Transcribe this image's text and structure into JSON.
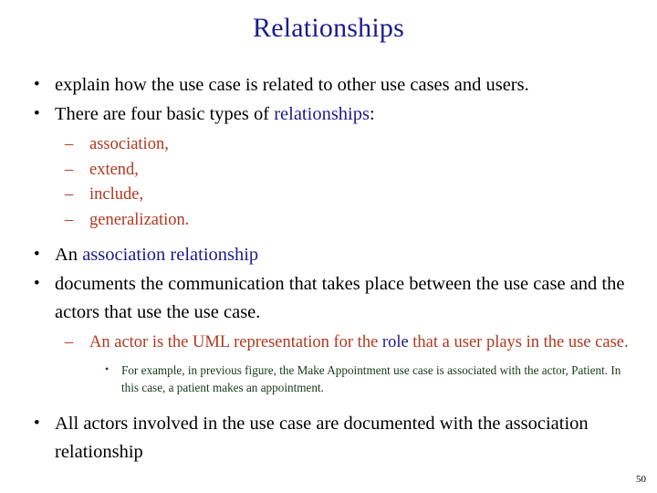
{
  "slide": {
    "title": "Relationships",
    "page_number": "50",
    "colors": {
      "title_blue": "#1b1b8f",
      "accent_red": "#b0381f",
      "accent_green": "#173a17",
      "body_black": "#000000",
      "background": "#ffffff"
    },
    "bullets": {
      "b1_explain": "explain how the use case is related to other use cases and users.",
      "b2_there_are_pre": "There are four basic types of ",
      "b2_there_are_blue": "relationships",
      "b2_there_are_post": ":",
      "types": [
        "association,",
        "extend,",
        "include,",
        "generalization."
      ],
      "b3_an_pre": "An ",
      "b3_an_blue": "association relationship",
      "b4_documents_line1": "documents the communication that takes place between the use",
      "b4_documents_line2": "case and the actors that use the use case.",
      "b5_actor_pre": "An actor is the UML representation for the ",
      "b5_actor_blue": "role",
      "b5_actor_post": " that a user plays in the use case.",
      "b6_example_line1": "For example, in previous figure, the Make Appointment use case is associated",
      "b6_example_line2": "with the actor, Patient. In this case, a patient makes an appointment.",
      "b7_all_actors": "All actors involved in the use case are documented with the association relationship"
    }
  }
}
